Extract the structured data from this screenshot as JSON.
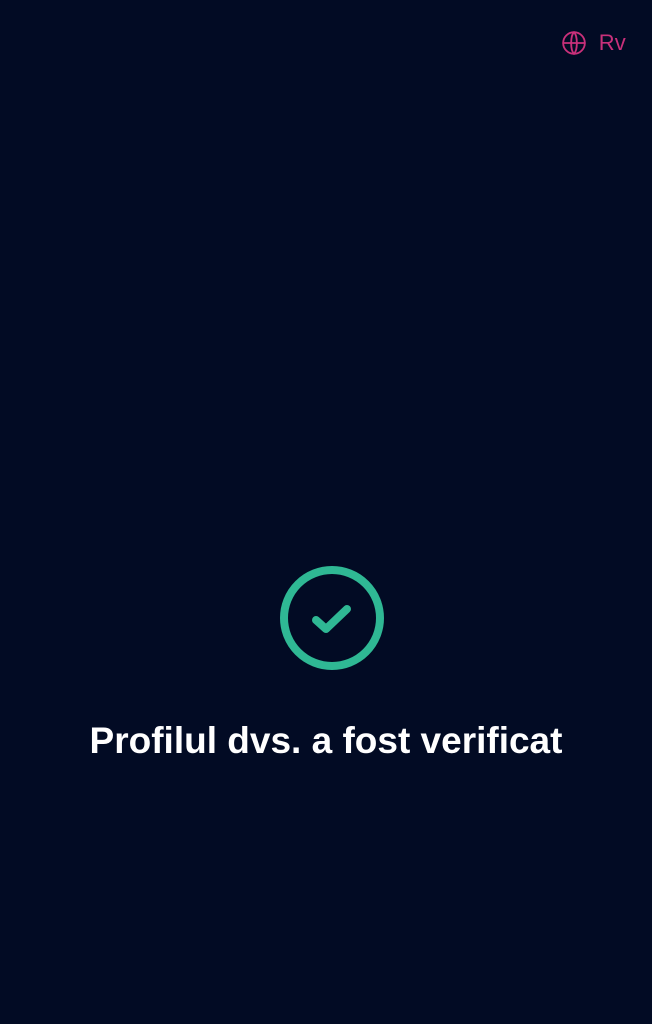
{
  "header": {
    "language_label": "Rv",
    "language_icon": "globe-icon"
  },
  "status": {
    "icon": "check-circle-icon",
    "title": "Profilul dvs. a fost verificat"
  },
  "colors": {
    "background": "#020b24",
    "accent": "#c9307a",
    "success": "#2fb894",
    "text": "#ffffff"
  }
}
